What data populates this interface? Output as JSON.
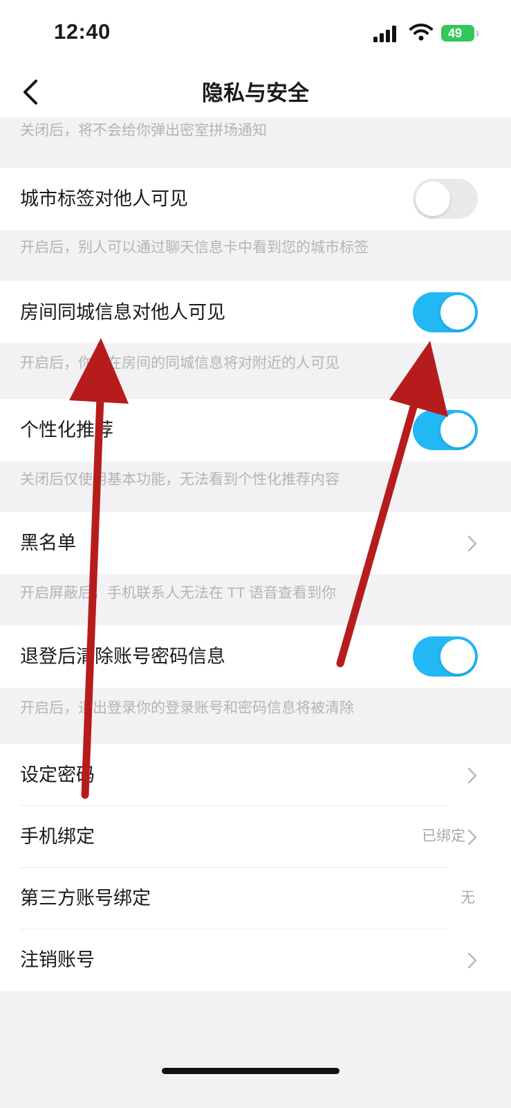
{
  "status_bar": {
    "time": "12:40",
    "battery": "49"
  },
  "header": {
    "title": "隐私与安全"
  },
  "top_hint": "关闭后，将不会给你弹出密室拼场通知",
  "settings": [
    {
      "label": "城市标签对他人可见",
      "control": "toggle",
      "on": false,
      "desc": "开启后，别人可以通过聊天信息卡中看到您的城市标签"
    },
    {
      "label": "房间同城信息对他人可见",
      "control": "toggle",
      "on": true,
      "desc": "开启后，你所在房间的同城信息将对附近的人可见"
    },
    {
      "label": "个性化推荐",
      "control": "toggle",
      "on": true,
      "desc": "关闭后仅使用基本功能，无法看到个性化推荐内容"
    },
    {
      "label": "黑名单",
      "control": "chevron",
      "desc": "开启屏蔽后，手机联系人无法在 TT 语音查看到你"
    },
    {
      "label": "退登后清除账号密码信息",
      "control": "toggle",
      "on": true,
      "desc": "开启后，退出登录你的登录账号和密码信息将被清除"
    }
  ],
  "account": [
    {
      "label": "设定密码",
      "value": ""
    },
    {
      "label": "手机绑定",
      "value": "已绑定"
    },
    {
      "label": "第三方账号绑定",
      "value": "无"
    },
    {
      "label": "注销账号",
      "value": ""
    }
  ],
  "colors": {
    "toggle_on": "#21b8f5",
    "toggle_off": "#e9e9eb",
    "annotation_arrow": "#b71c1c",
    "battery": "#34c759"
  },
  "icons": {
    "back": "chevron-left-icon",
    "row_arrow": "chevron-right-icon"
  }
}
